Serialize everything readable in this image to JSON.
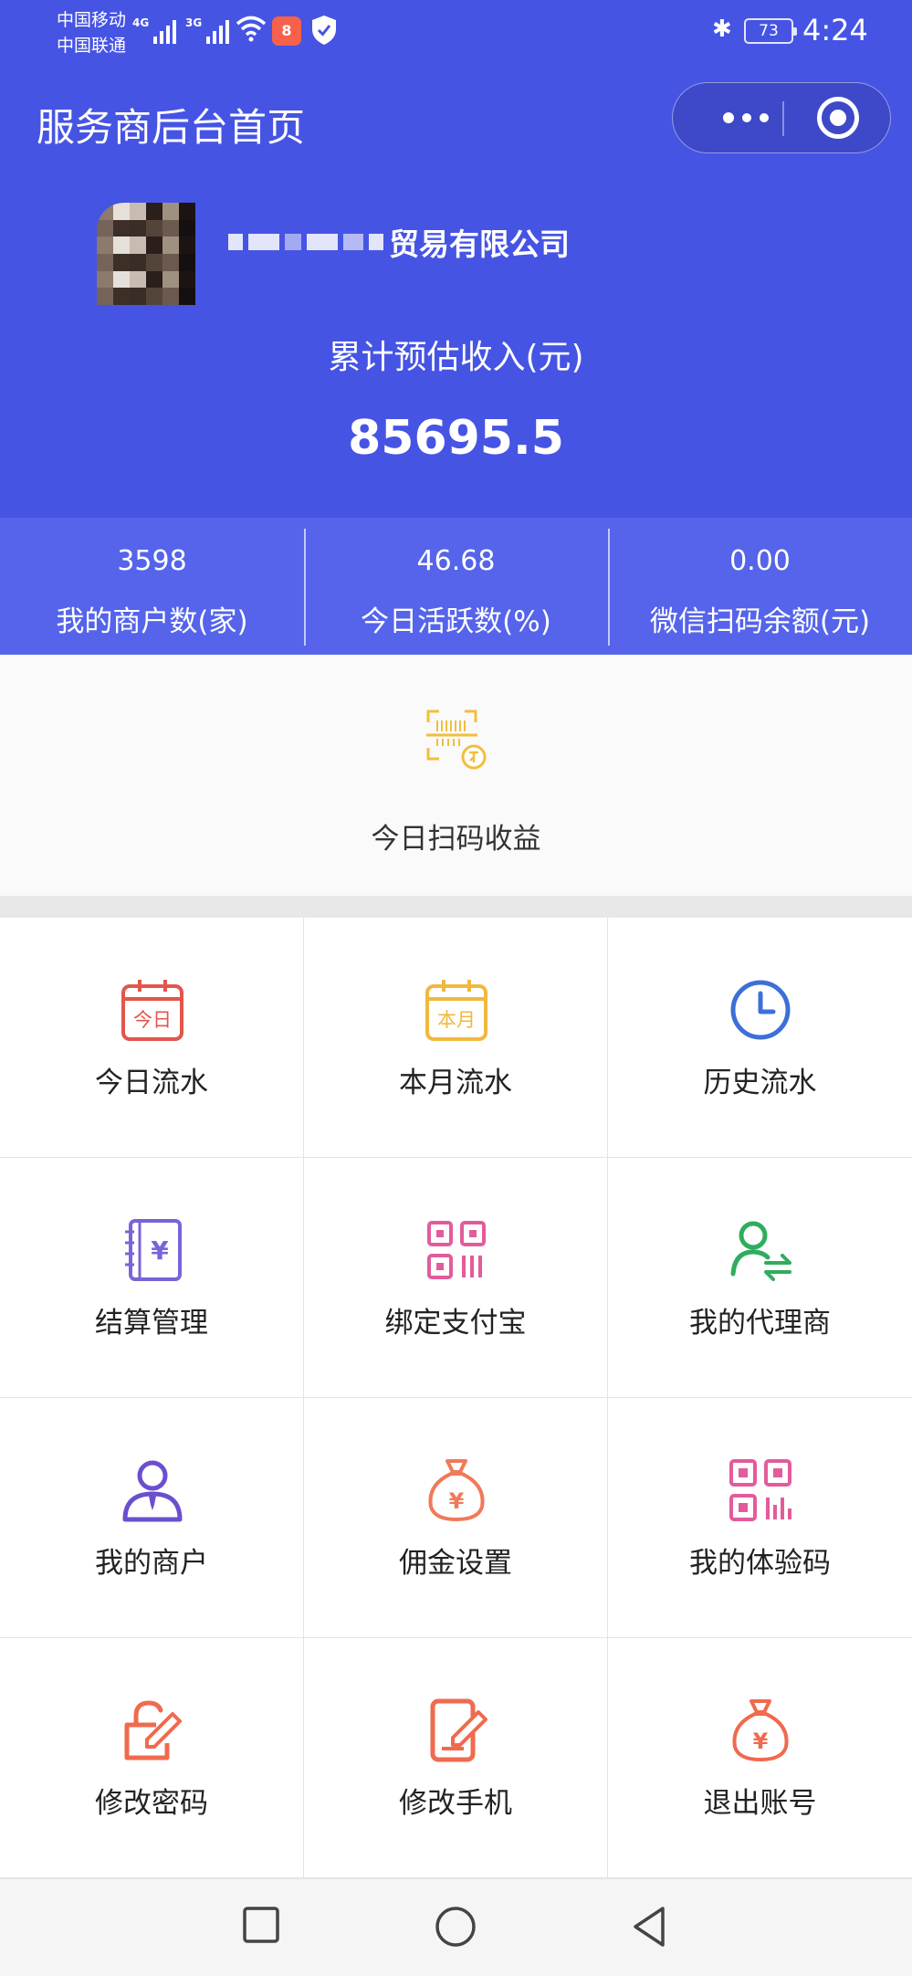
{
  "status_bar": {
    "carrier_1": "中国移动",
    "carrier_2": "中国联通",
    "signal_1_tag": "4G",
    "signal_2_tag": "3G",
    "app_badge": "8",
    "battery": "73",
    "time": "4:24",
    "icons": [
      "wifi-icon",
      "shield-icon",
      "bluetooth-icon",
      "battery-icon"
    ]
  },
  "nav": {
    "title": "服务商后台首页",
    "menu_icon": "more-dots-icon",
    "close_icon": "target-icon"
  },
  "profile": {
    "company_suffix": "贸易有限公司",
    "income_label": "累计预估收入(元)",
    "income_value": "85695.5"
  },
  "stats": [
    {
      "value": "3598",
      "label": "我的商户数(家)"
    },
    {
      "value": "46.68",
      "label": "今日活跃数(%)"
    },
    {
      "value": "0.00",
      "label": "微信扫码余额(元)"
    }
  ],
  "scan_income": {
    "label": "今日扫码收益",
    "icon": "scan-receipt-icon",
    "icon_color": "#f2bf3c"
  },
  "menu": [
    {
      "label": "今日流水",
      "icon": "calendar-today-icon",
      "icon_text": "今日",
      "color": "#e2564b"
    },
    {
      "label": "本月流水",
      "icon": "calendar-month-icon",
      "icon_text": "本月",
      "color": "#f0b83e"
    },
    {
      "label": "历史流水",
      "icon": "clock-icon",
      "color": "#3d6fd8"
    },
    {
      "label": "结算管理",
      "icon": "ledger-icon",
      "icon_text": "¥",
      "color": "#7b63d8"
    },
    {
      "label": "绑定支付宝",
      "icon": "qr-code-icon",
      "color": "#e25c9b"
    },
    {
      "label": "我的代理商",
      "icon": "user-transfer-icon",
      "color": "#2fad5e"
    },
    {
      "label": "我的商户",
      "icon": "merchant-user-icon",
      "color": "#6b4fcf"
    },
    {
      "label": "佣金设置",
      "icon": "money-bag-icon",
      "icon_text": "¥",
      "color": "#ef7a5a"
    },
    {
      "label": "我的体验码",
      "icon": "qr-code-icon",
      "color": "#e25c9b"
    },
    {
      "label": "修改密码",
      "icon": "lock-edit-icon",
      "color": "#ef6a4f"
    },
    {
      "label": "修改手机",
      "icon": "phone-edit-icon",
      "color": "#ef6a4f"
    },
    {
      "label": "退出账号",
      "icon": "money-bag-icon",
      "icon_text": "¥",
      "color": "#ef6a4f"
    }
  ],
  "system_nav": {
    "icons": [
      "recent-apps-icon",
      "home-icon",
      "back-icon"
    ]
  },
  "colors": {
    "header_bg": "#4654e4",
    "stats_bg": "#5564ea"
  }
}
